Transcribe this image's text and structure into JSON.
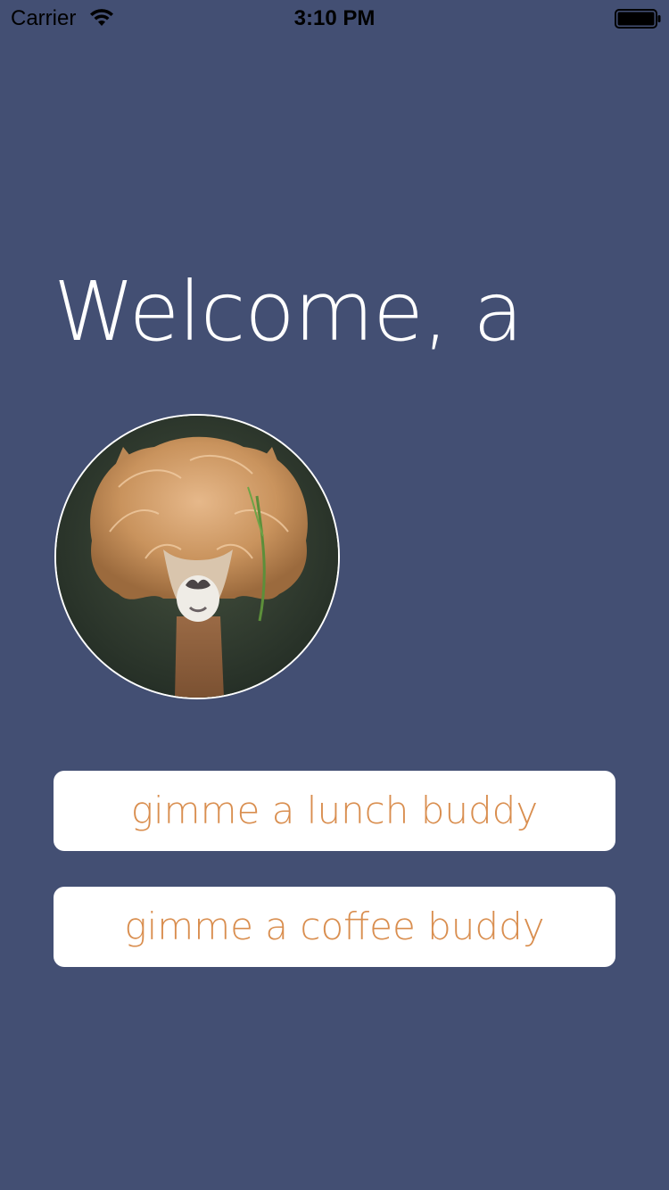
{
  "status_bar": {
    "carrier": "Carrier",
    "time": "3:10 PM",
    "wifi_icon": "wifi-icon",
    "battery_icon": "battery-icon"
  },
  "main": {
    "welcome_text": "Welcome, a",
    "avatar_image": "alpaca-photo",
    "lunch_button_label": "gimme a lunch buddy",
    "coffee_button_label": "gimme a coffee buddy"
  },
  "colors": {
    "background": "#434f73",
    "button_background": "#ffffff",
    "button_text": "#d98e4f",
    "heading_text": "#ffffff"
  }
}
